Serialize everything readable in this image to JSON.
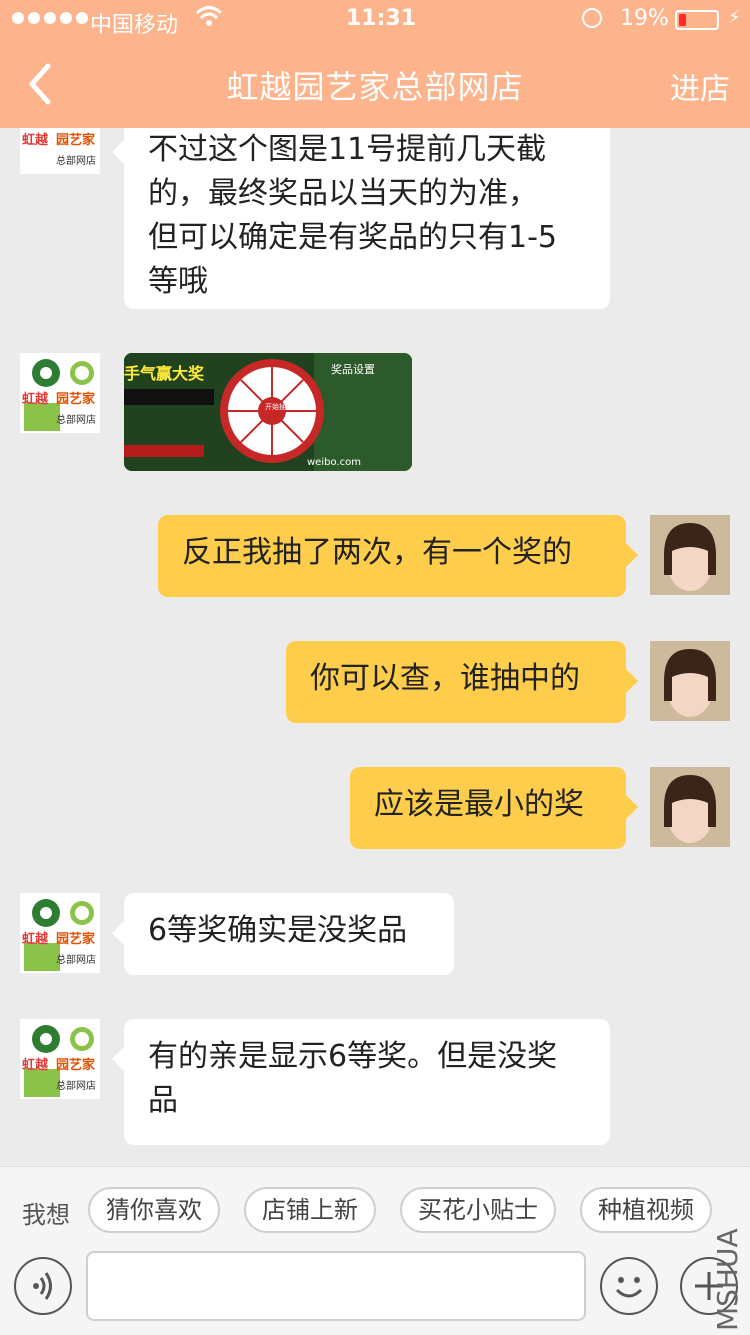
{
  "status_bar": {
    "carrier": "中国移动",
    "time": "11:31",
    "battery_percent": "19%",
    "battery_level": 0.19
  },
  "nav": {
    "title": "虹越园艺家总部网店",
    "right_action": "进店"
  },
  "messages": [
    {
      "from": "shop",
      "type": "text",
      "lines": [
        "不过这个图是11号提前几天截",
        "的，最终奖品以当天的为准，",
        "但可以确定是有奖品的只有1-5",
        "等哦"
      ]
    },
    {
      "from": "shop",
      "type": "image",
      "image_text": {
        "banner": "手气赢大奖",
        "prize_title": "奖品设置",
        "wheel_center": "开始抽奖",
        "weibo": "weibo.com"
      }
    },
    {
      "from": "user",
      "type": "text",
      "lines": [
        "反正我抽了两次，有一个奖的"
      ]
    },
    {
      "from": "user",
      "type": "text",
      "lines": [
        "你可以查，谁抽中的"
      ]
    },
    {
      "from": "user",
      "type": "text",
      "lines": [
        "应该是最小的奖"
      ]
    },
    {
      "from": "shop",
      "type": "text",
      "lines": [
        "6等奖确实是没奖品"
      ]
    },
    {
      "from": "shop",
      "type": "text",
      "lines": [
        "有的亲是显示6等奖。但是没奖",
        "品"
      ]
    }
  ],
  "shop_avatar": {
    "line1": "虹越",
    "line2": "园艺家",
    "line3": "总部网店"
  },
  "quick_replies": {
    "label": "我想",
    "chips": [
      "猜你喜欢",
      "店铺上新",
      "买花小贴士",
      "种植视频"
    ]
  },
  "watermark": "MSHUA",
  "icons": {
    "back": "chevron-left-icon",
    "voice": "voice-icon",
    "emoji": "emoji-icon",
    "plus": "plus-icon"
  },
  "colors": {
    "nav_bg": "#fdb38b",
    "outgoing_bubble": "#fdcd4b",
    "incoming_bubble": "#ffffff",
    "chat_bg": "#ebebeb"
  }
}
